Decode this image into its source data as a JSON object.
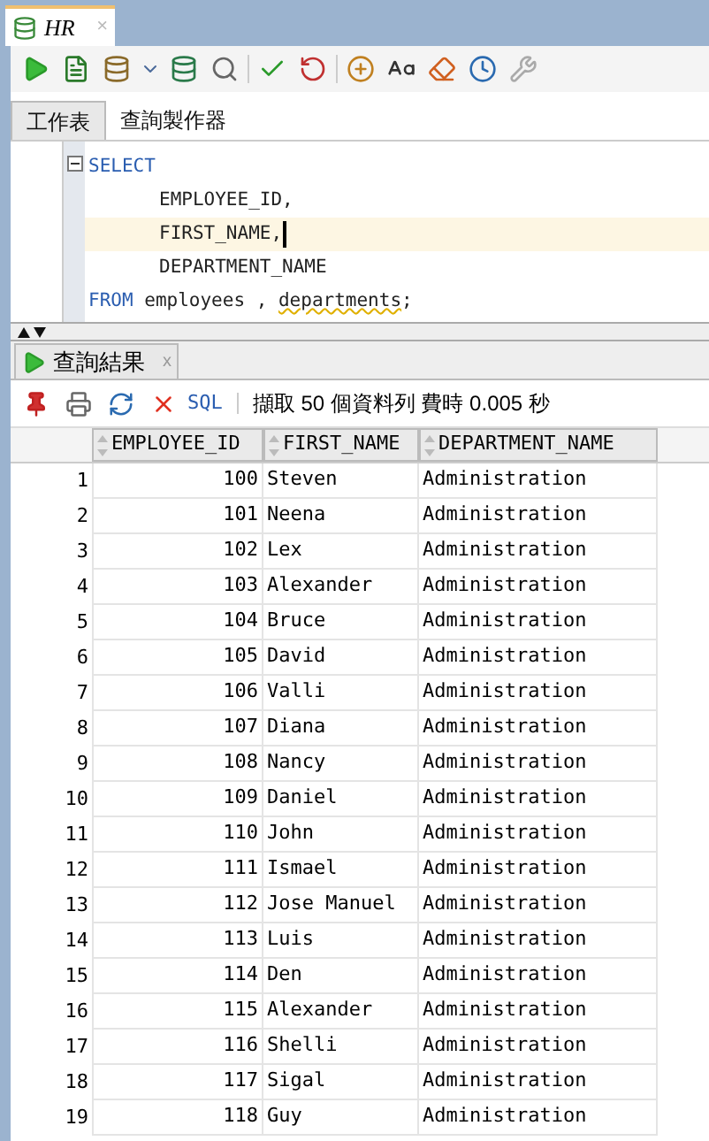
{
  "document_tab": {
    "title": "HR",
    "close": "×"
  },
  "editor_tabs": [
    {
      "label": "工作表",
      "selected": true
    },
    {
      "label": "查詢製作器",
      "selected": false
    }
  ],
  "editor": {
    "lines": [
      {
        "indent": false,
        "current": false,
        "parts": [
          {
            "kind": "keyword",
            "text": "SELECT"
          }
        ]
      },
      {
        "indent": true,
        "current": false,
        "parts": [
          {
            "kind": "ident",
            "text": "EMPLOYEE_ID,"
          }
        ]
      },
      {
        "indent": true,
        "current": true,
        "parts": [
          {
            "kind": "ident",
            "text": "FIRST_NAME,"
          }
        ]
      },
      {
        "indent": true,
        "current": false,
        "parts": [
          {
            "kind": "ident",
            "text": "DEPARTMENT_NAME"
          }
        ]
      },
      {
        "indent": false,
        "current": false,
        "parts": [
          {
            "kind": "keyword",
            "text": "FROM"
          },
          {
            "kind": "plain",
            "text": " employees , "
          },
          {
            "kind": "warning",
            "text": "departments"
          },
          {
            "kind": "plain",
            "text": ";"
          }
        ]
      }
    ]
  },
  "results_tab": {
    "title": "查詢結果",
    "close": "x"
  },
  "results_toolbar": {
    "sql_link": "SQL",
    "status": "擷取 50 個資料列 費時 0.005 秒"
  },
  "table": {
    "columns": [
      "",
      "EMPLOYEE_ID",
      "FIRST_NAME",
      "DEPARTMENT_NAME"
    ],
    "rows": [
      [
        "1",
        "100",
        "Steven",
        "Administration"
      ],
      [
        "2",
        "101",
        "Neena",
        "Administration"
      ],
      [
        "3",
        "102",
        "Lex",
        "Administration"
      ],
      [
        "4",
        "103",
        "Alexander",
        "Administration"
      ],
      [
        "5",
        "104",
        "Bruce",
        "Administration"
      ],
      [
        "6",
        "105",
        "David",
        "Administration"
      ],
      [
        "7",
        "106",
        "Valli",
        "Administration"
      ],
      [
        "8",
        "107",
        "Diana",
        "Administration"
      ],
      [
        "9",
        "108",
        "Nancy",
        "Administration"
      ],
      [
        "10",
        "109",
        "Daniel",
        "Administration"
      ],
      [
        "11",
        "110",
        "John",
        "Administration"
      ],
      [
        "12",
        "111",
        "Ismael",
        "Administration"
      ],
      [
        "13",
        "112",
        "Jose Manuel",
        "Administration"
      ],
      [
        "14",
        "113",
        "Luis",
        "Administration"
      ],
      [
        "15",
        "114",
        "Den",
        "Administration"
      ],
      [
        "16",
        "115",
        "Alexander",
        "Administration"
      ],
      [
        "17",
        "116",
        "Shelli",
        "Administration"
      ],
      [
        "18",
        "117",
        "Sigal",
        "Administration"
      ],
      [
        "19",
        "118",
        "Guy",
        "Administration"
      ]
    ]
  }
}
